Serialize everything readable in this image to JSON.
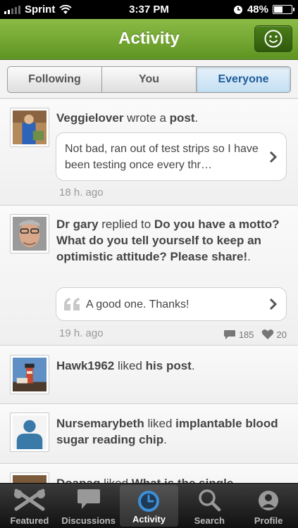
{
  "status": {
    "carrier": "Sprint",
    "time": "3:37 PM",
    "battery": "48%",
    "battery_level": 0.48
  },
  "nav": {
    "title": "Activity"
  },
  "segments": [
    "Following",
    "You",
    "Everyone"
  ],
  "feed": [
    {
      "user": "Veggielover",
      "action": " wrote a ",
      "target": "post",
      "tail": ".",
      "preview": "Not bad, ran out of test strips so I have been testing once every thr…",
      "time": "18 h. ago"
    },
    {
      "user": "Dr gary",
      "action": " replied to ",
      "target": "Do you have a motto?  What do you tell yourself to keep an optimistic attitude? Please share!",
      "tail": ".",
      "preview": "A good one.  Thanks!",
      "time": "19 h. ago",
      "comments": "185",
      "likes": "20"
    },
    {
      "user": "Hawk1962",
      "action": " liked ",
      "target": "his post",
      "tail": "."
    },
    {
      "user": "Nursemarybeth",
      "action": " liked ",
      "target": "implantable blood sugar reading chip",
      "tail": "."
    },
    {
      "user": "Doapag",
      "action": " liked ",
      "target": "What is the single"
    }
  ],
  "tabs": [
    "Featured",
    "Discussions",
    "Activity",
    "Search",
    "Profile"
  ],
  "colors": {
    "nav_green": "#6fa42f",
    "segment_active": "#1f5c99"
  }
}
